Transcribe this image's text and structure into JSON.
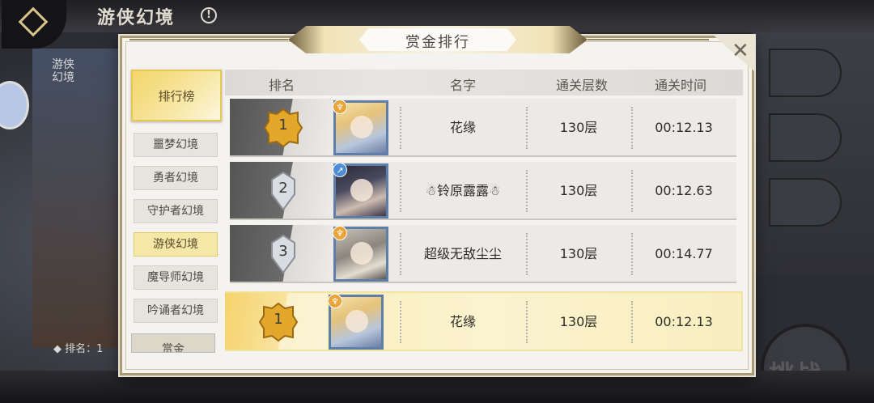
{
  "background": {
    "title": "游侠幻境",
    "side_label": "游侠幻境",
    "rank_label": "◆ 排名：1",
    "challenge": "挑战"
  },
  "modal": {
    "title": "赏金排行",
    "close_icon": "close-icon"
  },
  "sidebar": {
    "ranking_tab": "排行榜",
    "items": [
      {
        "label": "噩梦幻境",
        "active": false
      },
      {
        "label": "勇者幻境",
        "active": false
      },
      {
        "label": "守护者幻境",
        "active": false
      },
      {
        "label": "游侠幻境",
        "active": true
      },
      {
        "label": "魔导师幻境",
        "active": false
      },
      {
        "label": "吟诵者幻境",
        "active": false
      }
    ],
    "reward_tab": "赏金"
  },
  "table": {
    "headers": [
      "排名",
      "名字",
      "通关层数",
      "通关时间"
    ],
    "rows": [
      {
        "rank": "1",
        "name": "花缘",
        "floors": "130层",
        "time": "00:12.13",
        "medal": "gold"
      },
      {
        "rank": "2",
        "name": "☃铃原露露☃",
        "floors": "130层",
        "time": "00:12.63",
        "medal": "silver"
      },
      {
        "rank": "3",
        "name": "超级无敌尘尘",
        "floors": "130层",
        "time": "00:14.77",
        "medal": "silver"
      }
    ],
    "my_row": {
      "rank": "1",
      "name": "花缘",
      "floors": "130层",
      "time": "00:12.13",
      "medal": "gold"
    }
  },
  "colors": {
    "accent_gold": "#f5d36c",
    "active_tab": "#f5e7a6",
    "panel_bg": "#f4f3ef"
  }
}
